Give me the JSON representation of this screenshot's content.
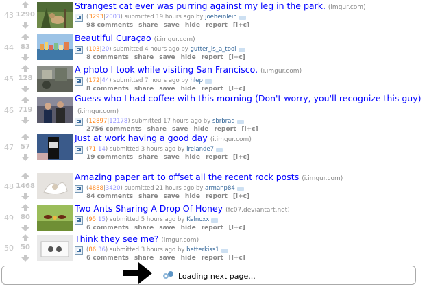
{
  "posts": [
    {
      "rank": "43",
      "score": "1290",
      "title": "Strangest cat ever was purring against my leg in the park.",
      "domain": "(imgur.com)",
      "ups": "3293",
      "downs": "2003",
      "time": "submitted 19 hours ago by",
      "user": "joeheinlein",
      "comments": "98 comments",
      "thumb": "cat"
    },
    {
      "rank": "44",
      "score": "83",
      "title": "Beautiful Curaçao",
      "domain": "(i.imgur.com)",
      "ups": "103",
      "downs": "20",
      "time": "submitted 4 hours ago by",
      "user": "gutter_is_a_tool",
      "comments": "8 comments",
      "thumb": "curacao"
    },
    {
      "rank": "45",
      "score": "128",
      "title": "A photo I took while visiting San Francisco.",
      "domain": "(i.imgur.com)",
      "ups": "172",
      "downs": "44",
      "time": "submitted 7 hours ago by",
      "user": "hlep",
      "comments": "8 comments",
      "thumb": "sf"
    },
    {
      "rank": "46",
      "score": "719",
      "title": "Guess who I had coffee with this morning (Don't worry, you'll recognize this guy)",
      "domain": "(i.imgur.com)",
      "ups": "12897",
      "downs": "12178",
      "time": "submitted 17 hours ago by",
      "user": "sbrbrad",
      "comments": "2756 comments",
      "thumb": "coffee"
    },
    {
      "rank": "47",
      "score": "57",
      "title": "Just at work having a good day",
      "domain": "(i.imgur.com)",
      "ups": "71",
      "downs": "14",
      "time": "submitted 3 hours ago by",
      "user": "irelande7",
      "comments": "19 comments",
      "thumb": "work"
    },
    {
      "rank": "48",
      "score": "1468",
      "title": "Amazing paper art to offset all the recent rock posts",
      "domain": "(i.imgur.com)",
      "ups": "4888",
      "downs": "3420",
      "time": "submitted 21 hours ago by",
      "user": "armanp84",
      "comments": "84 comments",
      "thumb": "paper"
    },
    {
      "rank": "49",
      "score": "80",
      "title": "Two Ants Sharing A Drop Of Honey",
      "domain": "(fc07.deviantart.net)",
      "ups": "95",
      "downs": "15",
      "time": "submitted 5 hours ago by",
      "user": "Kelnoxx",
      "comments": "6 comments",
      "thumb": "ants"
    },
    {
      "rank": "50",
      "score": "50",
      "title": "Think they see me?",
      "domain": "(imgur.com)",
      "ups": "86",
      "downs": "36",
      "time": "submitted 3 hours ago by",
      "user": "betterkiss1",
      "comments": "6 comments",
      "thumb": "see"
    }
  ],
  "buttons": {
    "share": "share",
    "save": "save",
    "hide": "hide",
    "report": "report",
    "lc": "[l+c]"
  },
  "loading": {
    "text": "Loading next page..."
  },
  "colors": {
    "title": "#0000ff",
    "upvotes": "#ff8b24",
    "downvotes": "#9494ff",
    "user": "#336699"
  }
}
